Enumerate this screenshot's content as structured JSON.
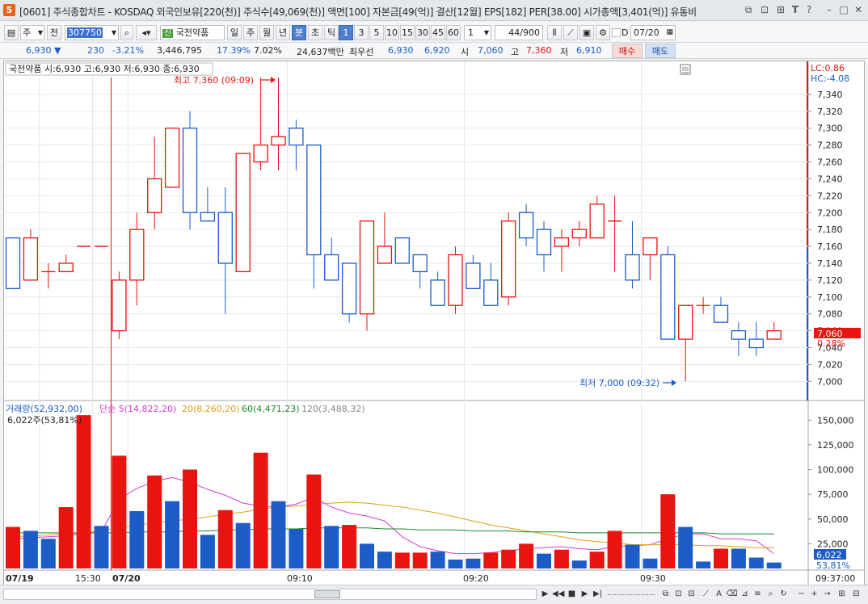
{
  "window": {
    "app_icon": "5",
    "title": "[0601] 주식종합차트 - KOSDAQ 외국인보유[220(천)] 주식수[49,069(천)] 액면[100] 자본금[49(억)] 결산[12월] EPS[182] PER[38.00] 시가총액[3,401(억)] 유통비",
    "controls": [
      "restore-icon",
      "link-icon",
      "lock-icon",
      "text-icon",
      "help-icon",
      "minimize-icon",
      "maximize-icon",
      "close-icon"
    ]
  },
  "toolbar": {
    "period_select": "주",
    "prev_label": "전",
    "code_value": "307750",
    "stock_tag": "신",
    "stock_name": "국전약품",
    "period_buttons": [
      "일",
      "주",
      "월",
      "년",
      "분",
      "초",
      "틱"
    ],
    "active_period": "분",
    "interval_buttons": [
      "1",
      "3",
      "5",
      "10",
      "15",
      "30",
      "45",
      "60"
    ],
    "active_interval": "1",
    "interval_select": "1",
    "count_value": "44",
    "count_total": "/900",
    "d_label": "D",
    "date_value": "07/20"
  },
  "pricebar": {
    "price": "6,930",
    "change": "230",
    "change_pct": "-3.21%",
    "volume": "3,446,795",
    "turnover_pct": "17.39%",
    "ratio_pct": "7.02%",
    "amount": "24,637백만",
    "quote_label": "최우선",
    "ask": "6,930",
    "bid": "6,920",
    "open_label": "시",
    "open": "7,060",
    "high_label": "고",
    "high": "7,360",
    "low_label": "저",
    "low": "6,910",
    "buy_label": "매수",
    "sell_label": "매도"
  },
  "chart_header": {
    "stock_label": "국전약품 시:6,930 고:6,930 저:6,930 종:6,930",
    "lc": "LC:0.86",
    "hc": "HC:-4.08",
    "high_annotation": "최고 7,360 (09:09)",
    "low_annotation": "최저 7,000 (09:32)",
    "current_price_tag": "7,060",
    "current_pct_tag": "0.28%"
  },
  "volume_header": {
    "volume_label": "거래량(52,932,00)",
    "ma5_label": "단순 5(14,822,20)",
    "ma20_label": "20(8,260,20)",
    "ma60_label": "60(4,471,23)",
    "ma120_label": "120(3,488,32)",
    "shares_label": "6,022주(53,81%)",
    "current_volume_tag": "6,022",
    "current_volume_pct": "53,81%"
  },
  "time_axis": {
    "labels": [
      "07/19",
      "15:30",
      "07/20",
      "09:10",
      "09:20",
      "09:30",
      "09:37:00"
    ]
  },
  "colors": {
    "up": "#e8140f",
    "down": "#1b5cc8",
    "ma5": "#d23bd2",
    "ma20": "#e0a010",
    "ma60": "#1a8a2a",
    "ma120": "#888888",
    "accent_bar": "#e8140f"
  },
  "chart_data": [
    {
      "type": "candlestick",
      "title": "국전약품",
      "ylim": [
        6985,
        7360
      ],
      "y_ticks": [
        7000,
        7020,
        7040,
        7060,
        7080,
        7100,
        7120,
        7140,
        7160,
        7180,
        7200,
        7220,
        7240,
        7260,
        7280,
        7300,
        7320,
        7340
      ],
      "candles": [
        {
          "o": 7170,
          "h": 7170,
          "l": 7110,
          "c": 7110
        },
        {
          "o": 7120,
          "h": 7180,
          "l": 7120,
          "c": 7170
        },
        {
          "o": 7130,
          "h": 7140,
          "l": 7110,
          "c": 7130
        },
        {
          "o": 7130,
          "h": 7150,
          "l": 7130,
          "c": 7140
        },
        {
          "o": 7160,
          "h": 7160,
          "l": 7160,
          "c": 7160
        },
        {
          "o": 7160,
          "h": 7160,
          "l": 7160,
          "c": 7160
        },
        {
          "o": 7060,
          "h": 7130,
          "l": 7050,
          "c": 7120
        },
        {
          "o": 7120,
          "h": 7200,
          "l": 7090,
          "c": 7180
        },
        {
          "o": 7200,
          "h": 7290,
          "l": 7180,
          "c": 7240
        },
        {
          "o": 7230,
          "h": 7300,
          "l": 7230,
          "c": 7300
        },
        {
          "o": 7300,
          "h": 7320,
          "l": 7180,
          "c": 7200
        },
        {
          "o": 7200,
          "h": 7230,
          "l": 7190,
          "c": 7190
        },
        {
          "o": 7200,
          "h": 7230,
          "l": 7080,
          "c": 7140
        },
        {
          "o": 7130,
          "h": 7270,
          "l": 7130,
          "c": 7270
        },
        {
          "o": 7260,
          "h": 7360,
          "l": 7250,
          "c": 7280
        },
        {
          "o": 7280,
          "h": 7360,
          "l": 7250,
          "c": 7290
        },
        {
          "o": 7300,
          "h": 7310,
          "l": 7250,
          "c": 7280
        },
        {
          "o": 7280,
          "h": 7280,
          "l": 7110,
          "c": 7150
        },
        {
          "o": 7150,
          "h": 7170,
          "l": 7120,
          "c": 7120
        },
        {
          "o": 7140,
          "h": 7140,
          "l": 7070,
          "c": 7080
        },
        {
          "o": 7080,
          "h": 7190,
          "l": 7060,
          "c": 7190
        },
        {
          "o": 7140,
          "h": 7200,
          "l": 7140,
          "c": 7160
        },
        {
          "o": 7170,
          "h": 7170,
          "l": 7140,
          "c": 7140
        },
        {
          "o": 7150,
          "h": 7150,
          "l": 7110,
          "c": 7130
        },
        {
          "o": 7120,
          "h": 7130,
          "l": 7090,
          "c": 7090
        },
        {
          "o": 7090,
          "h": 7160,
          "l": 7080,
          "c": 7150
        },
        {
          "o": 7140,
          "h": 7150,
          "l": 7110,
          "c": 7110
        },
        {
          "o": 7120,
          "h": 7140,
          "l": 7090,
          "c": 7090
        },
        {
          "o": 7100,
          "h": 7200,
          "l": 7090,
          "c": 7190
        },
        {
          "o": 7200,
          "h": 7210,
          "l": 7160,
          "c": 7170
        },
        {
          "o": 7180,
          "h": 7190,
          "l": 7130,
          "c": 7150
        },
        {
          "o": 7160,
          "h": 7180,
          "l": 7130,
          "c": 7170
        },
        {
          "o": 7170,
          "h": 7190,
          "l": 7160,
          "c": 7180
        },
        {
          "o": 7170,
          "h": 7220,
          "l": 7170,
          "c": 7210
        },
        {
          "o": 7190,
          "h": 7220,
          "l": 7130,
          "c": 7190
        },
        {
          "o": 7150,
          "h": 7190,
          "l": 7110,
          "c": 7120
        },
        {
          "o": 7150,
          "h": 7170,
          "l": 7120,
          "c": 7170
        },
        {
          "o": 7150,
          "h": 7160,
          "l": 7050,
          "c": 7050
        },
        {
          "o": 7050,
          "h": 7090,
          "l": 7000,
          "c": 7090
        },
        {
          "o": 7090,
          "h": 7100,
          "l": 7080,
          "c": 7090
        },
        {
          "o": 7090,
          "h": 7100,
          "l": 7070,
          "c": 7070
        },
        {
          "o": 7060,
          "h": 7070,
          "l": 7030,
          "c": 7050
        },
        {
          "o": 7050,
          "h": 7070,
          "l": 7030,
          "c": 7040
        },
        {
          "o": 7050,
          "h": 7070,
          "l": 7050,
          "c": 7060
        }
      ]
    },
    {
      "type": "bar",
      "title": "거래량",
      "ylim": [
        0,
        160000
      ],
      "y_ticks": [
        25000,
        50000,
        75000,
        100000,
        125000,
        150000
      ],
      "y_tick_labels": [
        "25,000",
        "50,000",
        "75,000",
        "100,000",
        "125,000",
        "150,000"
      ],
      "values": [
        42000,
        38000,
        30000,
        62000,
        155000,
        43000,
        114000,
        58000,
        94000,
        68000,
        100000,
        34000,
        59000,
        46000,
        117000,
        68000,
        40000,
        95000,
        43000,
        44000,
        25000,
        17000,
        16000,
        16000,
        17000,
        9000,
        10000,
        16000,
        19000,
        25000,
        15000,
        19000,
        8000,
        17000,
        38000,
        24000,
        10000,
        75000,
        42000,
        7000,
        20000,
        20000,
        11000,
        6022
      ],
      "colors": [
        "up",
        "down",
        "down",
        "up",
        "up",
        "down",
        "up",
        "down",
        "up",
        "down",
        "up",
        "down",
        "up",
        "down",
        "up",
        "down",
        "down",
        "up",
        "down",
        "up",
        "down",
        "down",
        "up",
        "up",
        "down",
        "down",
        "down",
        "up",
        "up",
        "up",
        "down",
        "up",
        "down",
        "up",
        "up",
        "down",
        "down",
        "up",
        "down",
        "down",
        "up",
        "down",
        "down",
        "down"
      ],
      "series": [
        {
          "name": "단순 5",
          "values": [
            30000,
            31000,
            32000,
            33000,
            35000,
            37000,
            70000,
            81000,
            88000,
            92000,
            87000,
            80000,
            74000,
            66000,
            63000,
            62000,
            65000,
            72000,
            62000,
            56000,
            53000,
            48000,
            32000,
            22000,
            18000,
            15000,
            15000,
            16000,
            18000,
            20000,
            21000,
            22000,
            20000,
            19000,
            22000,
            23000,
            24000,
            30000,
            35000,
            35000,
            30000,
            30000,
            28000,
            15000
          ]
        },
        {
          "name": "20",
          "values": [
            32000,
            33000,
            34000,
            35000,
            36000,
            38000,
            41000,
            44000,
            46000,
            48000,
            50000,
            52000,
            55000,
            57000,
            60000,
            62000,
            63000,
            65000,
            66000,
            67000,
            66000,
            64000,
            62000,
            59000,
            56000,
            52000,
            48000,
            44000,
            41000,
            38000,
            35000,
            32000,
            29000,
            27000,
            26000,
            24000,
            24000,
            24000,
            24000,
            23000,
            23000,
            22000,
            21000,
            21000
          ]
        },
        {
          "name": "60",
          "values": [
            36000,
            36000,
            36000,
            36000,
            36000,
            36000,
            36000,
            37000,
            37000,
            37000,
            38000,
            38000,
            39000,
            39000,
            40000,
            40000,
            40000,
            41000,
            41000,
            41000,
            41000,
            40000,
            40000,
            39000,
            39000,
            39000,
            38000,
            38000,
            38000,
            37000,
            37000,
            37000,
            36000,
            36000,
            36000,
            36000,
            36000,
            36000,
            36000,
            36000,
            35000,
            35000,
            35000,
            35000
          ]
        }
      ]
    }
  ]
}
